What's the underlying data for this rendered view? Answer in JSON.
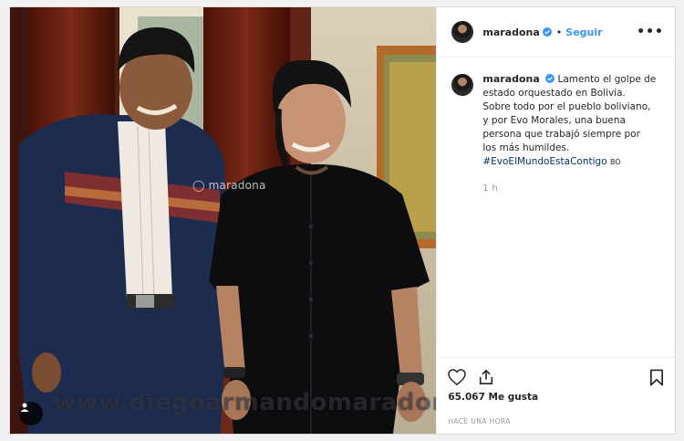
{
  "post": {
    "username": "maradona",
    "follow_label": "Seguir",
    "separator": "•",
    "more_label": "•••",
    "caption_text": "Lamento el golpe de estado orquestado en Bolivia. Sobre todo por el pueblo boliviano, y por Evo Morales, una buena persona que trabajó siempre por los más humildes.",
    "hashtag": "#EvoElMundoEstaContigo",
    "location_code": "BO",
    "time_ago": "1 h",
    "likes": "65.067 Me gusta",
    "date_label": "HACE UNA HORA"
  },
  "photo": {
    "watermark_handle": "maradona",
    "watermark_site": "www.diegoarmandomaradona.com"
  },
  "icons": {
    "verified": "verified-badge-icon",
    "like": "heart-icon",
    "share": "share-icon",
    "save": "bookmark-icon",
    "tagged": "person-tag-icon",
    "instagram": "instagram-icon"
  },
  "colors": {
    "accent": "#3897f0",
    "hashtag": "#003569",
    "muted": "#999999",
    "text": "#262626"
  }
}
